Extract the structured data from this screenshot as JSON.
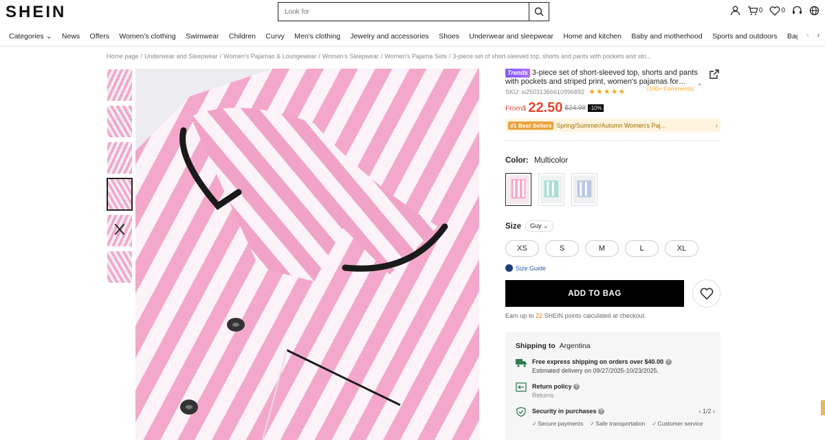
{
  "header": {
    "logo": "SHEIN",
    "search_placeholder": "Look for",
    "cart_count": "0",
    "wishlist_count": "0"
  },
  "nav": {
    "items": [
      "Categories",
      "News",
      "Offers",
      "Women's clothing",
      "Swimwear",
      "Children",
      "Curvy",
      "Men's clothing",
      "Jewelry and accessories",
      "Shoes",
      "Underwear and sleepwear",
      "Home and kitchen",
      "Baby and motherhood",
      "Sports and outdoors",
      "Bags and"
    ]
  },
  "breadcrumb": [
    "Home page",
    "Underwear and Sleepwear",
    "Women's Pajamas & Loungewear",
    "Women's Sleepwear",
    "Women's Pajama Sets",
    "3-piece set of short-sleeved top, shorts and pants with pockets and stri..."
  ],
  "product": {
    "badge": "Trends",
    "title": "3-piece set of short-sleeved top, shorts and pants with pockets and striped print, women's pajamas for…",
    "sku": "SKU: si25031366610996892",
    "stars": "★★★★★",
    "comments": "(100+ Comments)",
    "price_from": "From$",
    "price": "22.50",
    "old_price": "$24.98",
    "discount": "-10%",
    "best_badge": "#1 Best Sellers",
    "best_category": "Spring/Summer/Autumn Women's Paj…",
    "color_label": "Color:",
    "color_value": "Multicolor",
    "size_label": "Size",
    "size_system": "Guy",
    "sizes": [
      "XS",
      "S",
      "M",
      "L",
      "XL"
    ],
    "size_guide": "Size Guide",
    "add_to_bag": "ADD TO BAG",
    "earn_prefix": "Earn up to ",
    "earn_points": "22",
    "earn_suffix": " SHEIN points calculated at checkout."
  },
  "shipping": {
    "label": "Shipping to",
    "country": "Argentina",
    "express_title": "Free express shipping on orders over $40.00",
    "express_sub": "Estimated delivery on 09/27/2025-10/23/2025.",
    "return_title": "Return policy",
    "return_sub": "Returns",
    "security_title": "Security in purchases",
    "security_pager": "1/2",
    "security_items": [
      "Secure payments",
      "Safe transportation",
      "Customer service"
    ]
  },
  "colors": {
    "pink": "#f4a9cc",
    "price_red": "#e4472b",
    "stars": "#f5a623"
  }
}
